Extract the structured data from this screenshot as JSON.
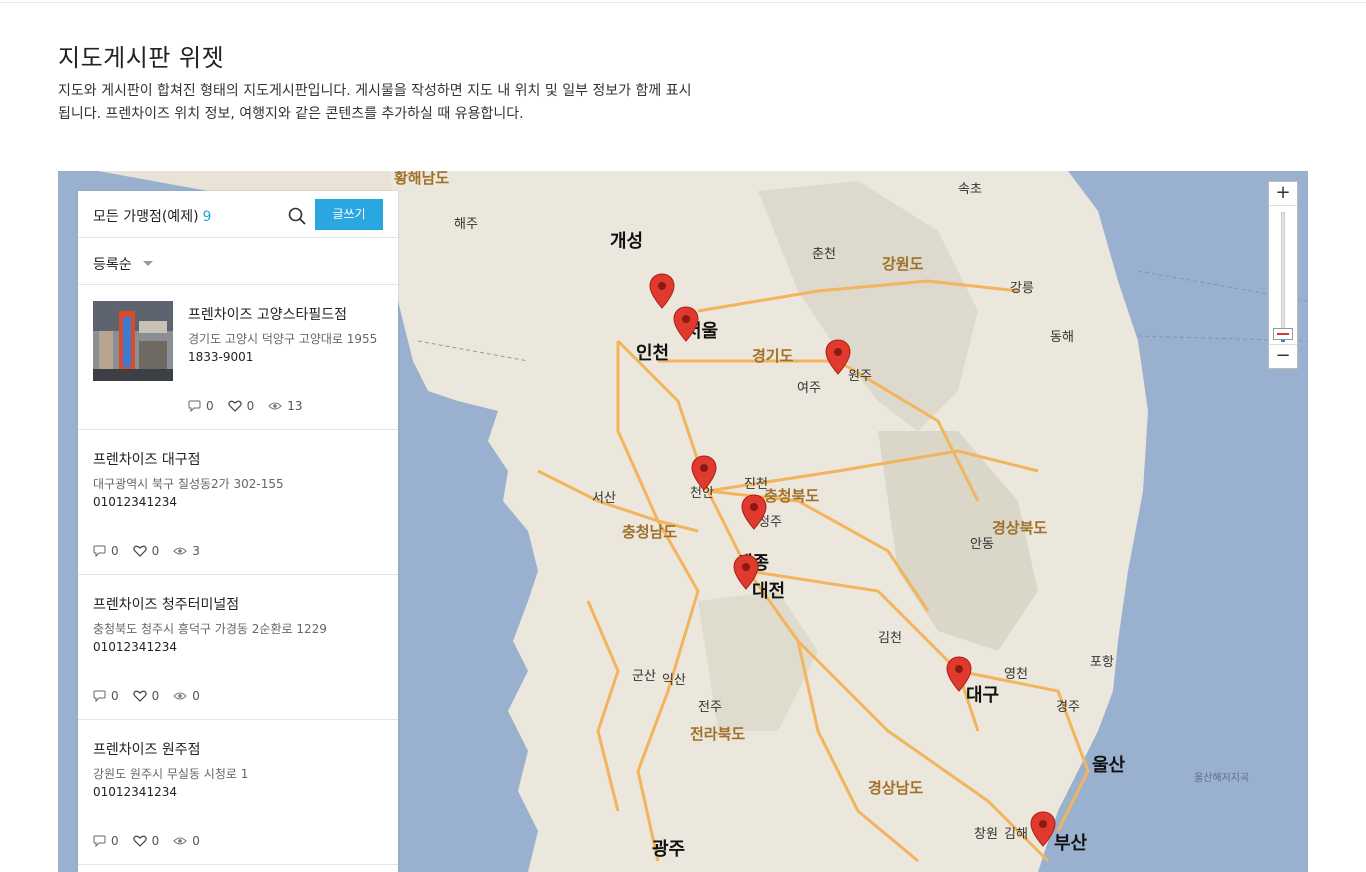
{
  "page": {
    "title": "지도게시판 위젯",
    "description": "지도와 게시판이 합쳐진 형태의 지도게시판입니다. 게시물을 작성하면 지도 내 위치 및 일부 정보가 함께 표시됩니다. 프렌차이즈 위치 정보, 여행지와 같은 콘텐츠를 추가하실 때 유용합니다."
  },
  "panel": {
    "title": "모든 가맹점(예제)",
    "count": "9",
    "write_label": "글쓰기",
    "sort_label": "등록순"
  },
  "items": [
    {
      "name": "프렌차이즈 고양스타필드점",
      "address": "경기도 고양시 덕양구 고양대로 1955",
      "phone": "1833-9001",
      "comments": "0",
      "likes": "0",
      "views": "13"
    },
    {
      "name": "프렌차이즈 대구점",
      "address": "대구광역시 북구 칠성동2가 302-155",
      "phone": "01012341234",
      "comments": "0",
      "likes": "0",
      "views": "3"
    },
    {
      "name": "프렌차이즈 청주터미널점",
      "address": "충청북도 청주시 흥덕구 가경동 2순환로 1229",
      "phone": "01012341234",
      "comments": "0",
      "likes": "0",
      "views": "0"
    },
    {
      "name": "프렌차이즈 원주점",
      "address": "강원도 원주시 무실동 시청로 1",
      "phone": "01012341234",
      "comments": "0",
      "likes": "0",
      "views": "0"
    }
  ],
  "map": {
    "zoom_in": "+",
    "zoom_out": "−",
    "labels": {
      "gaeseong": "개성",
      "incheon": "인천",
      "seoul": "서울",
      "daejeon": "대전",
      "daegu": "대구",
      "ulsan": "울산",
      "busan": "부산",
      "gwangju": "광주",
      "sejong": "세종",
      "gangwon": "강원도",
      "gyeonggi": "경기도",
      "chungbuk": "충청북도",
      "chungnam": "충청남도",
      "gyeongbuk": "경상북도",
      "jeonbuk": "전라북도",
      "gyeongnam": "경상남도",
      "hwanghae": "황해남도",
      "chuncheon": "춘천",
      "wonju": "원주",
      "gangneung": "강릉",
      "donghae": "동해",
      "sokcho": "속초",
      "pohang": "포항",
      "gimcheon": "김천",
      "gunsan": "군산",
      "seosan": "서산",
      "yeoju": "여주",
      "cheonan": "천안",
      "jincheon": "진천",
      "cheongju": "청주",
      "andong": "안동",
      "gyeongju": "경주",
      "jeonju": "전주",
      "iksan": "익산",
      "changwon": "창원",
      "gimhae": "김해",
      "yeongcheon": "영천",
      "haeju": "해주",
      "sea1": "울산해저지곡"
    }
  }
}
